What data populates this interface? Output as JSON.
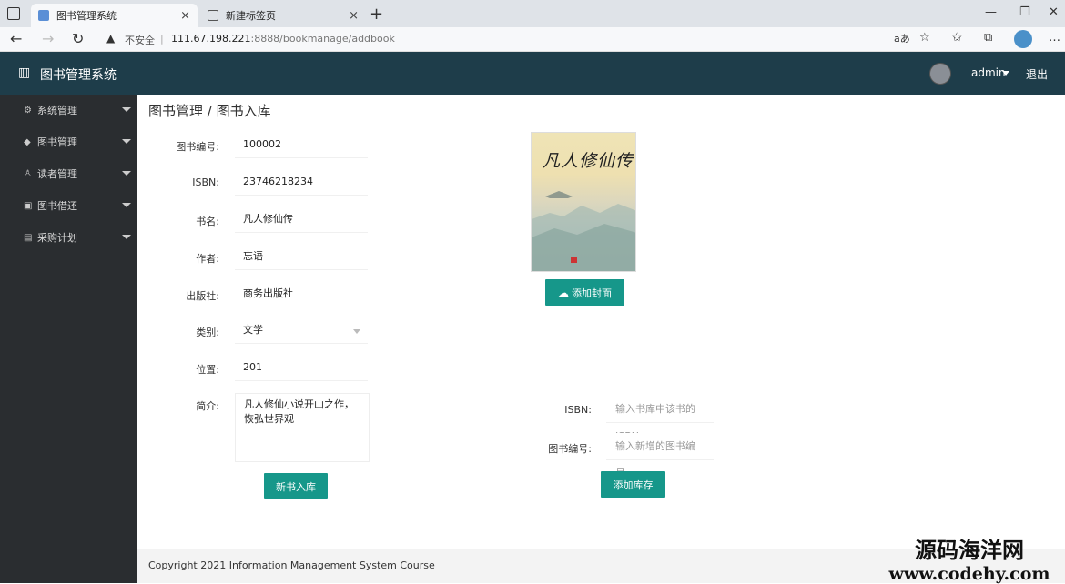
{
  "browser": {
    "tabs": [
      {
        "title": "图书管理系统"
      },
      {
        "title": "新建标签页"
      }
    ],
    "close_glyph": "×",
    "new_tab_glyph": "+",
    "security_label": "不安全",
    "url_host": "111.67.198.221",
    "url_rest": ":8888/bookmanage/addbook",
    "read_aloud": "aあ",
    "window_buttons": [
      "—",
      "❐",
      "✕"
    ]
  },
  "app": {
    "title": "图书管理系统",
    "user": "admin",
    "logout": "退出"
  },
  "sidebar": {
    "items": [
      {
        "label": "系统管理",
        "icon": "gear-icon"
      },
      {
        "label": "图书管理",
        "icon": "book-icon"
      },
      {
        "label": "读者管理",
        "icon": "user-icon"
      },
      {
        "label": "图书借还",
        "icon": "exchange-icon"
      },
      {
        "label": "采购计划",
        "icon": "clipboard-icon"
      }
    ]
  },
  "breadcrumb": "图书管理 / 图书入库",
  "form": {
    "book_no": {
      "label": "图书编号:",
      "value": "100002"
    },
    "isbn": {
      "label": "ISBN:",
      "value": "23746218234"
    },
    "name": {
      "label": "书名:",
      "value": "凡人修仙传"
    },
    "author": {
      "label": "作者:",
      "value": "忘语"
    },
    "publisher": {
      "label": "出版社:",
      "value": "商务出版社"
    },
    "category": {
      "label": "类别:",
      "value": "文学"
    },
    "location": {
      "label": "位置:",
      "value": "201"
    },
    "intro": {
      "label": "简介:",
      "value": "凡人修仙小说开山之作，恢弘世界观"
    },
    "submit": "新书入库"
  },
  "cover": {
    "title_art": "凡人修仙传",
    "upload_button": "添加封面"
  },
  "stock": {
    "isbn_label": "ISBN:",
    "isbn_placeholder": "输入书库中该书的ISBN",
    "book_no_label": "图书编号:",
    "book_no_placeholder": "输入新增的图书编号",
    "button": "添加库存"
  },
  "footer": "Copyright 2021 Information Management System Course",
  "watermark": {
    "line1": "源码海洋网",
    "line2": "www.codehy.com"
  },
  "colors": {
    "header_bg": "#1e3d4a",
    "sidebar_bg": "#2a2d30",
    "accent": "#16978a"
  }
}
